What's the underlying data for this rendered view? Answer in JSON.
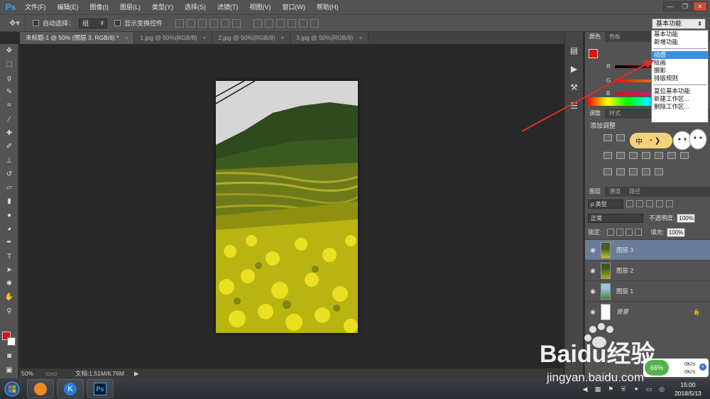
{
  "app": {
    "logo": "Ps"
  },
  "menu": [
    "文件(F)",
    "编辑(E)",
    "图像(I)",
    "图层(L)",
    "类型(Y)",
    "选择(S)",
    "滤镜(T)",
    "视图(V)",
    "窗口(W)",
    "帮助(H)"
  ],
  "options": {
    "auto_select_label": "自动选择：",
    "auto_select_value": "组",
    "show_transform_label": "显示变换控件",
    "workspace_value": "基本功能"
  },
  "tabs": [
    "未标题-1 @ 50% (图层 3, RGB/8) *",
    "1.jpg @ 50%(RGB/8)",
    "2.jpg @ 50%(RGB/8)",
    "3.jpg @ 50%(RGB/8)"
  ],
  "tab_close": "×",
  "status": {
    "zoom": "50%",
    "doc": "文档:1.51M/6.76M"
  },
  "color_panel": {
    "tabs": [
      "颜色",
      "色板"
    ],
    "channels": [
      "R",
      "G",
      "B"
    ]
  },
  "adjust_panel": {
    "tabs": [
      "调整",
      "样式"
    ],
    "title": "添加调整"
  },
  "layers_panel": {
    "tabs": [
      "图层",
      "通道",
      "路径"
    ],
    "kind": "ρ 类型",
    "blend": "正常",
    "opacity_label": "不透明度:",
    "opacity_value": "100%",
    "lock_label": "锁定:",
    "fill_label": "填充:",
    "fill_value": "100%",
    "layers": [
      "图层 3",
      "图层 2",
      "图层 1",
      "背景"
    ]
  },
  "workspace_menu": {
    "items_a": [
      "基本功能",
      "新增功能"
    ],
    "items_b": [
      "动感",
      "绘画",
      "摄影",
      "排版规则"
    ],
    "items_c": [
      "复位基本功能",
      "新建工作区...",
      "删除工作区..."
    ],
    "highlighted": "动感"
  },
  "ime": {
    "label": "中"
  },
  "net_widget": {
    "percent": "66%",
    "up": "0K/s",
    "down": "0K/s"
  },
  "watermark": {
    "text": "Baidu经验",
    "url": "jingyan.baidu.com"
  },
  "taskbar": {
    "time": "15:00",
    "date": "2018/5/13"
  },
  "colors": {
    "accent_red": "#e01010",
    "highlight": "#3c8fe0",
    "selected_layer": "#6b7c99"
  }
}
